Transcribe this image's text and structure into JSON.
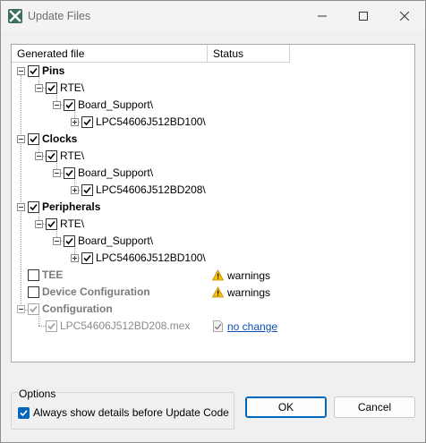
{
  "window": {
    "title": "Update Files",
    "accent": "#0067c0"
  },
  "table": {
    "columns": [
      "Generated file",
      "Status"
    ]
  },
  "tree": {
    "pins": {
      "label": "Pins",
      "rte": "RTE\\",
      "board": "Board_Support\\",
      "device": "LPC54606J512BD100\\"
    },
    "clocks": {
      "label": "Clocks",
      "rte": "RTE\\",
      "board": "Board_Support\\",
      "device": "LPC54606J512BD208\\"
    },
    "peripherals": {
      "label": "Peripherals",
      "rte": "RTE\\",
      "board": "Board_Support\\",
      "device": "LPC54606J512BD100\\"
    },
    "tee": {
      "label": "TEE",
      "status": "warnings"
    },
    "device_config": {
      "label": "Device Configuration",
      "status": "warnings"
    },
    "configuration": {
      "label": "Configuration",
      "file": "LPC54606J512BD208.mex",
      "status": "no change"
    }
  },
  "options": {
    "legend": "Options",
    "always_show": "Always show details before Update Code",
    "always_show_checked": true
  },
  "buttons": {
    "ok": "OK",
    "cancel": "Cancel"
  }
}
